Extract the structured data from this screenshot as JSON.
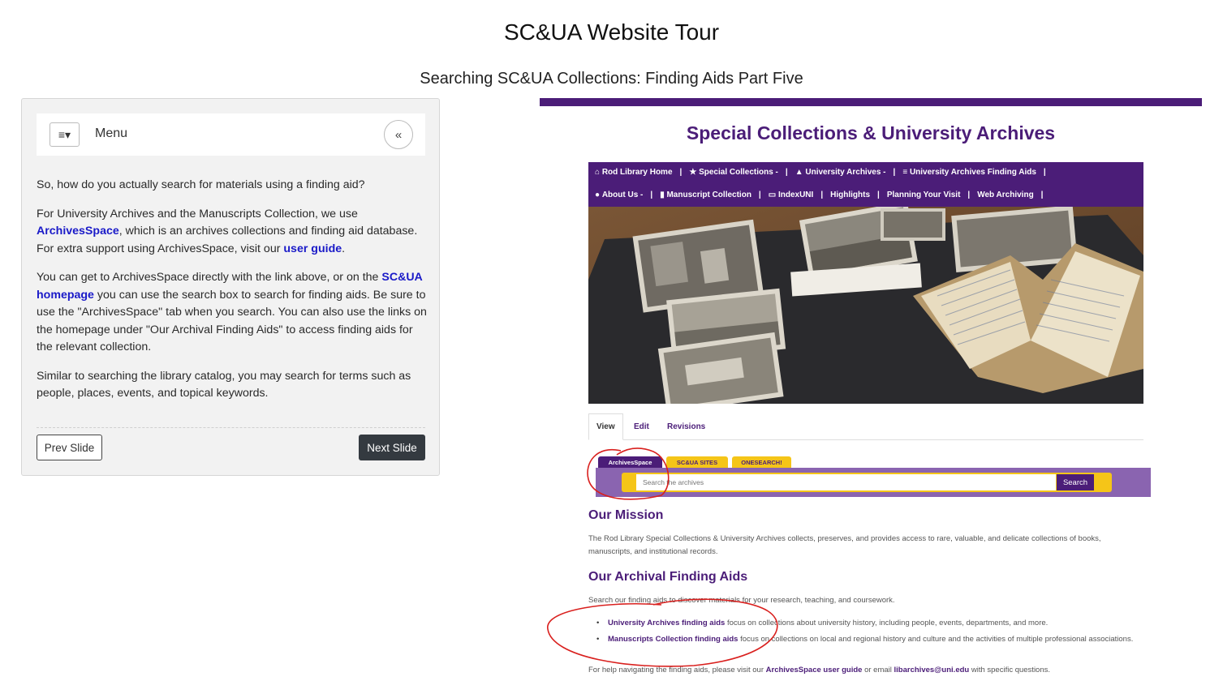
{
  "title": "SC&UA Website Tour",
  "subtitle": "Searching SC&UA Collections: Finding Aids Part Five",
  "panel": {
    "menu_icon": "≡▾",
    "menu_label": "Menu",
    "collapse_icon": "«",
    "p1": "So, how do you actually search for materials using a finding aid?",
    "p2_a": "For University Archives and the Manuscripts Collection, we use ",
    "p2_link1": "ArchivesSpace",
    "p2_b": ", which is an archives collections and finding aid database. For extra support using ArchivesSpace, visit our ",
    "p2_link2": "user guide",
    "p2_c": ".",
    "p3_a": "You can get to ArchivesSpace directly with the link above, or on the ",
    "p3_link": "SC&UA homepage",
    "p3_b": " you can use the search box to search for finding aids. Be sure to use the \"ArchivesSpace\" tab when you search. You can also use the links on the homepage under \"Our Archival Finding Aids\" to access finding aids for the relevant collection.",
    "p4": "Similar to searching the library catalog, you may search for terms such as people, places, events, and topical keywords.",
    "prev": "Prev Slide",
    "next": "Next Slide"
  },
  "shot": {
    "title": "Special Collections & University Archives",
    "nav_row1": [
      "Rod Library Home",
      "Special Collections -",
      "University Archives -",
      "University Archives Finding Aids"
    ],
    "nav_row2": [
      "About Us -",
      "Manuscript Collection",
      "IndexUNI",
      "Highlights",
      "Planning Your Visit",
      "Web Archiving"
    ],
    "tabs": [
      "View",
      "Edit",
      "Revisions"
    ],
    "search_tabs": [
      "ArchivesSpace",
      "SC&UA SITES",
      "ONESEARCH!"
    ],
    "search_placeholder": "Search the archives",
    "search_button": "Search",
    "mission_heading": "Our Mission",
    "mission_text": "The Rod Library Special Collections & University Archives collects, preserves, and provides access to rare, valuable, and delicate collections of books, manuscripts, and institutional records.",
    "aids_heading": "Our Archival Finding Aids",
    "aids_intro": "Search our finding aids to discover materials for your research, teaching, and coursework.",
    "aid1_link": "University Archives finding aids",
    "aid1_text": " focus on collections about university history, including people, events, departments, and more.",
    "aid2_link": "Manuscripts Collection finding aids",
    "aid2_text": " focus on collections on local and regional history and culture and the activities of multiple professional associations.",
    "help_a": "For help navigating the finding aids, please visit our ",
    "help_link1": "ArchivesSpace user guide",
    "help_b": " or email ",
    "help_link2": "libarchives@uni.edu",
    "help_c": " with specific questions."
  }
}
